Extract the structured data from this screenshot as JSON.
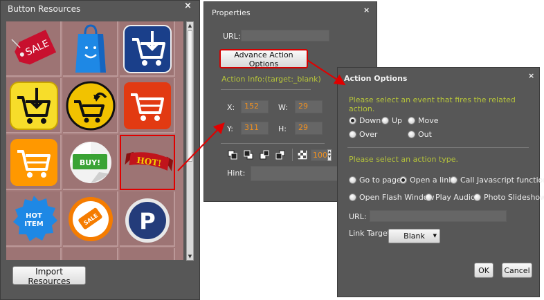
{
  "resources": {
    "title": "Button Resources",
    "close": "×",
    "import_label": "Import Resources",
    "icons": [
      {
        "name": "sale-tag-icon",
        "text": "SALE"
      },
      {
        "name": "shopping-bag-icon",
        "text": ""
      },
      {
        "name": "blue-cart-download-icon",
        "text": ""
      },
      {
        "name": "yellow-cart-download-icon",
        "text": ""
      },
      {
        "name": "round-cart-icon",
        "text": ""
      },
      {
        "name": "red-cart-icon",
        "text": ""
      },
      {
        "name": "orange-cart-icon",
        "text": ""
      },
      {
        "name": "buy-sticker-icon",
        "text": "BUY!"
      },
      {
        "name": "hot-ribbon-icon",
        "text": "HOT!"
      },
      {
        "name": "hot-item-badge-icon",
        "text": "HOT ITEM"
      },
      {
        "name": "sale-badge-icon",
        "text": "SALE"
      },
      {
        "name": "paypal-sticker-icon",
        "text": "P"
      }
    ]
  },
  "properties": {
    "title": "Properties",
    "close": "×",
    "url_label": "URL:",
    "url_value": "",
    "advance_button": "Advance Action Options",
    "action_info": "Action Info:(target:_blank)",
    "x_label": "X:",
    "x_value": "152",
    "w_label": "W:",
    "w_value": "29",
    "y_label": "Y:",
    "y_value": "311",
    "h_label": "H:",
    "h_value": "29",
    "opacity_value": "100",
    "hint_label": "Hint:"
  },
  "action_options": {
    "title": "Action Options",
    "close": "×",
    "event_prompt": "Please select an event that fires the related action.",
    "events": [
      {
        "label": "Down",
        "checked": true
      },
      {
        "label": "Up",
        "checked": false
      },
      {
        "label": "Move",
        "checked": false
      },
      {
        "label": "Over",
        "checked": false
      },
      {
        "label": "Out",
        "checked": false
      }
    ],
    "type_prompt": "Please select an action type.",
    "types": [
      {
        "label": "Go to page",
        "checked": false
      },
      {
        "label": "Open a link",
        "checked": true
      },
      {
        "label": "Call Javascript function",
        "checked": false
      },
      {
        "label": "Open Flash Window",
        "checked": false
      },
      {
        "label": "Play Audio",
        "checked": false
      },
      {
        "label": "Photo Slideshow",
        "checked": false
      }
    ],
    "url_label": "URL:",
    "url_value": "",
    "link_target_label": "Link Target:",
    "link_target_value": "Blank",
    "ok_label": "OK",
    "cancel_label": "Cancel"
  },
  "colors": {
    "panel_bg": "#575757",
    "highlight": "#e00000",
    "value_text": "#f09020",
    "hint_text": "#b6c43a"
  }
}
